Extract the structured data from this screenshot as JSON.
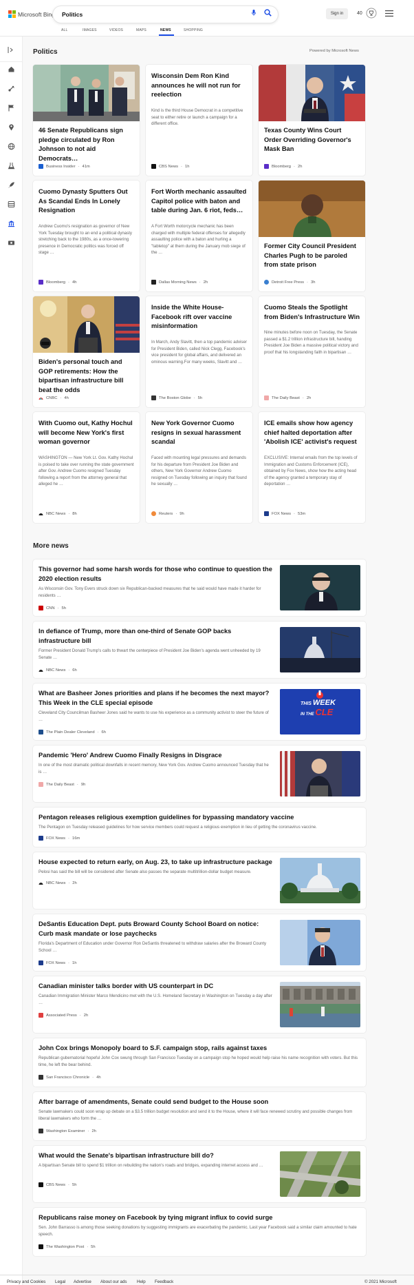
{
  "header": {
    "logo_text": "Microsoft Bing",
    "search_value": "Politics",
    "signin_label": "Sign in",
    "points": "40",
    "colors": {
      "accent": "#174ae4",
      "logo_red": "#f25022",
      "logo_green": "#7fba00",
      "logo_blue": "#00a4ef",
      "logo_yellow": "#ffb900"
    },
    "tabs": [
      {
        "label": "ALL"
      },
      {
        "label": "IMAGES"
      },
      {
        "label": "VIDEOS"
      },
      {
        "label": "MAPS"
      },
      {
        "label": "NEWS",
        "active": true
      },
      {
        "label": "SHOPPING"
      }
    ]
  },
  "sidebar": {
    "icons": [
      "expand-icon",
      "home-icon",
      "sports-icon",
      "flag-icon",
      "location-icon",
      "globe-icon",
      "science-icon",
      "rocket-icon",
      "entertainment-icon",
      "politics-icon",
      "money-icon"
    ]
  },
  "politics": {
    "title": "Politics",
    "powered_by": "Powered by Microsoft News",
    "cards": [
      {
        "title": "46 Senate Republicans sign pledge circulated by Ron Johnson to not aid Democrats…",
        "snippet": "",
        "provider": "Business Insider",
        "time": "41m"
      },
      {
        "title": "Wisconsin Dem Ron Kind announces he will not run for reelection",
        "snippet": "Kind is the third House Democrat in a competitive seat to either retire or launch a campaign for a different office.",
        "provider": "CBS News",
        "time": "1h"
      },
      {
        "title": "Texas County Wins Court Order Overriding Governor's Mask Ban",
        "snippet": "",
        "provider": "Bloomberg",
        "time": "2h"
      },
      {
        "title": "Cuomo Dynasty Sputters Out As Scandal Ends In Lonely Resignation",
        "snippet": "Andrew Cuomo's resignation as governor of New York Tuesday brought to an end a political dynasty stretching back to the 1980s, as a once-towering presence in Democratic politics was forced off stage …",
        "provider": "Bloomberg",
        "time": "4h"
      },
      {
        "title": "Fort Worth mechanic assaulted Capitol police with baton and table during Jan. 6 riot, feds…",
        "snippet": "A Fort Worth motorcycle mechanic has been charged with multiple federal offenses for allegedly assaulting police with a baton and hurling a \"tabletop\" at them during the January mob siege of the …",
        "provider": "Dallas Morning News",
        "time": "2h"
      },
      {
        "title": "Former City Council President Charles Pugh to be paroled from state prison",
        "snippet": "",
        "provider": "Detroit Free Press",
        "time": "3h"
      },
      {
        "title": "Biden's personal touch and GOP retirements: How the bipartisan infrastructure bill beat the odds",
        "snippet": "",
        "provider": "CNBC",
        "time": "4h"
      },
      {
        "title": "Inside the White House-Facebook rift over vaccine misinformation",
        "snippet": "In March, Andy Slavitt, then a top pandemic adviser for President Biden, called Nick Clegg, Facebook's vice president for global affairs, and delivered an ominous warning.For many weeks, Slavitt and …",
        "provider": "The Boston Globe",
        "time": "5h"
      },
      {
        "title": "Cuomo Steals the Spotlight from Biden's Infrastructure Win",
        "snippet": "Nine minutes before noon on Tuesday, the Senate passed a $1.2 trillion infrastructure bill, handing President Joe Biden a massive political victory and proof that his longstanding faith in bipartisan …",
        "provider": "The Daily Beast",
        "time": "2h"
      },
      {
        "title": "With Cuomo out, Kathy Hochul will become New York's first woman governor",
        "snippet": "WASHINGTON — New York Lt. Gov. Kathy Hochul is poised to take over running the state government after Gov. Andrew Cuomo resigned Tuesday following a report from the attorney general that alleged he …",
        "provider": "NBC News",
        "time": "8h"
      },
      {
        "title": "New York Governor Cuomo resigns in sexual harassment scandal",
        "snippet": "Faced with mounting legal pressures and demands for his departure from President Joe Biden and others, New York Governor Andrew Cuomo resigned on Tuesday following an inquiry that found he sexually …",
        "provider": "Reuters",
        "time": "9h"
      },
      {
        "title": "ICE emails show how agency chief halted deportation after 'Abolish ICE' activist's request",
        "snippet": "EXCLUSIVE: Internal emails from the top levels of Immigration and Customs Enforcement (ICE), obtained by Fox News, show how the acting head of the agency granted a temporary stay of deportation …",
        "provider": "FOX News",
        "time": "53m"
      }
    ]
  },
  "more_news": {
    "title": "More news",
    "items": [
      {
        "title": "This governor had some harsh words for those who continue to question the 2020 election results",
        "snippet": "As Wisconsin Gov. Tony Evers struck down six Republican-backed measures that he said would have made it harder for residents …",
        "provider": "CNN",
        "time": "5h"
      },
      {
        "title": "In defiance of Trump, more than one-third of Senate GOP backs infrastructure bill",
        "snippet": "Former President Donald Trump's calls to thwart the centerpiece of President Joe Biden's agenda went unheeded by 19 Senate …",
        "provider": "NBC News",
        "time": "6h"
      },
      {
        "title": "What are Basheer Jones priorities and plans if he becomes the next mayor? This Week in the CLE special episode",
        "snippet": "Cleveland City Councilman Basheer Jones said he wants to use his experience as a community activist to steer the future of …",
        "provider": "The Plain Dealer Cleveland",
        "time": "6h",
        "image_text": [
          "THIS",
          "WEEK",
          "IN THE",
          "CLE"
        ]
      },
      {
        "title": "Pandemic 'Hero' Andrew Cuomo Finally Resigns in Disgrace",
        "snippet": "In one of the most dramatic political downfalls in recent memory, New York Gov. Andrew Cuomo announced Tuesday that he is …",
        "provider": "The Daily Beast",
        "time": "9h"
      },
      {
        "title": "Pentagon releases religious exemption guidelines for bypassing mandatory vaccine",
        "snippet": "The Pentagon on Tuesday released guidelines for how service members could request a religious exemption in lieu of getting the coronavirus vaccine.",
        "provider": "FOX News",
        "time": "16m"
      },
      {
        "title": "House expected to return early, on Aug. 23, to take up infrastructure package",
        "snippet": "Pelosi has said the bill will be considered after Senate also passes the separate multitrillion-dollar budget measure.",
        "provider": "NBC News",
        "time": "2h"
      },
      {
        "title": "DeSantis Education Dept. puts Broward County School Board on notice: Curb mask mandate or lose paychecks",
        "snippet": "Florida's Department of Education under Governor Ron DeSantis threatened to withdraw salaries after the Broward County School …",
        "provider": "FOX News",
        "time": "1h"
      },
      {
        "title": "Canadian minister talks border with US counterpart in DC",
        "snippet": "Canadian Immigration Minister Marco Mendicino met with the U.S. Homeland Secretary in Washington on Tuesday a day after …",
        "provider": "Associated Press",
        "time": "2h"
      },
      {
        "title": "John Cox brings Monopoly board to S.F. campaign stop, rails against taxes",
        "snippet": "Republican gubernatorial hopeful John Cox swung through San Francisco Tuesday on a campaign stop he hoped would help raise his name recognition with voters. But this time, he left the bear behind.",
        "provider": "San Francisco Chronicle",
        "time": "4h"
      },
      {
        "title": "After barrage of amendments, Senate could send budget to the House soon",
        "snippet": "Senate lawmakers could soon wrap up debate on a $3.5 trillion budget resolution and send it to the House, where it will face renewed scrutiny and possible changes from liberal lawmakers who form the …",
        "provider": "Washington Examiner",
        "time": "2h"
      },
      {
        "title": "What would the Senate's bipartisan infrastructure bill do?",
        "snippet": "A bipartisan Senate bill to spend $1 trillion on rebuilding the nation's roads and bridges, expanding internet access and …",
        "provider": "CBS News",
        "time": "5h"
      },
      {
        "title": "Republicans raise money on Facebook by tying migrant influx to covid surge",
        "snippet": "Sen. John Barrasso is among those seeking donations by suggesting immigrants are exacerbating the pandemic. Last year Facebook said a similar claim amounted to hate speech.",
        "provider": "The Washington Post",
        "time": "5h"
      }
    ]
  },
  "footer": {
    "links": [
      "Privacy and Cookies",
      "Legal",
      "Advertise",
      "About our ads",
      "Help",
      "Feedback"
    ],
    "copyright": "© 2021 Microsoft"
  }
}
